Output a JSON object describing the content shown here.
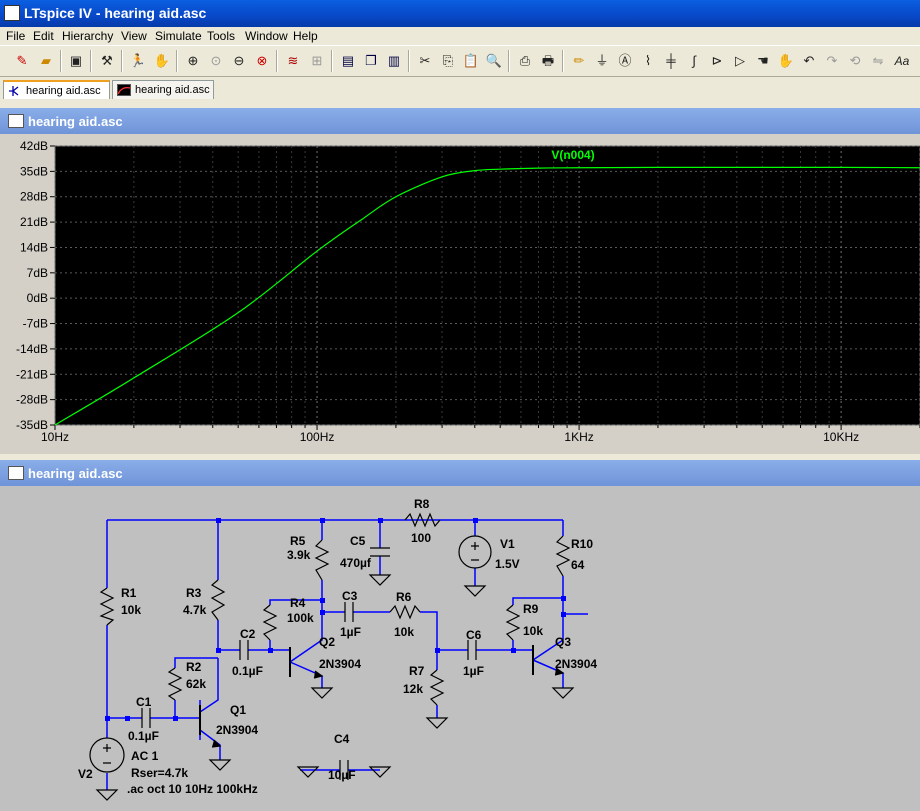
{
  "window": {
    "title": "LTspice IV - hearing aid.asc"
  },
  "menu": [
    "File",
    "Edit",
    "Hierarchy",
    "View",
    "Simulate",
    "Tools",
    "Window",
    "Help"
  ],
  "toolbar_icons": [
    "new-schematic-icon",
    "open-icon",
    "save-icon",
    "control-panel-icon",
    "run-icon",
    "pause-icon",
    "zoom-in-icon",
    "pan-icon",
    "zoom-out-icon",
    "zoom-cancel-icon",
    "autorange-icon",
    "fit-icon",
    "tile-horizontal-icon",
    "cascade-icon",
    "tile-vertical-icon",
    "cut-icon",
    "copy-icon",
    "paste-icon",
    "find-icon",
    "print-setup-icon",
    "print-icon",
    "draw-wire-icon",
    "ground-icon",
    "label-net-icon",
    "resistor-icon",
    "capacitor-icon",
    "inductor-icon",
    "diode-icon",
    "component-icon",
    "move-icon",
    "drag-icon",
    "undo-icon",
    "redo-icon",
    "rotate-icon",
    "mirror-icon",
    "text-icon"
  ],
  "tabs": [
    {
      "label": "hearing aid.asc",
      "icon": "schematic-icon"
    },
    {
      "label": "hearing aid.asc",
      "icon": "waveform-icon"
    }
  ],
  "plot_pane": {
    "title": "hearing aid.asc"
  },
  "schematic_pane": {
    "title": "hearing aid.asc"
  },
  "chart_data": {
    "type": "line",
    "series": [
      {
        "name": "V(n004)",
        "color": "#00ff00",
        "x": [
          10,
          20,
          50,
          100,
          150,
          200,
          300,
          400,
          500,
          700,
          1000,
          2000,
          5000,
          10000,
          20000
        ],
        "y": [
          -35,
          -22,
          -4,
          13,
          22,
          28,
          33.5,
          35.2,
          35.6,
          35.9,
          36,
          36.1,
          36.1,
          36.1,
          36
        ]
      }
    ],
    "x_scale": "log",
    "xlim": [
      10,
      20000
    ],
    "ylim": [
      -35,
      42
    ],
    "y_ticks": [
      "42dB",
      "35dB",
      "28dB",
      "21dB",
      "14dB",
      "7dB",
      "0dB",
      "-7dB",
      "-14dB",
      "-21dB",
      "-28dB",
      "-35dB"
    ],
    "x_ticks": [
      "10Hz",
      "100Hz",
      "1KHz",
      "10KHz"
    ],
    "grid": true,
    "background": "#000000"
  },
  "schematic": {
    "labels": {
      "R1": "R1",
      "R1v": "10k",
      "R2": "R2",
      "R2v": "62k",
      "R3": "R3",
      "R3v": "4.7k",
      "R4": "R4",
      "R4v": "100k",
      "R5": "R5",
      "R5v": "3.9k",
      "R6": "R6",
      "R6v": "10k",
      "R7": "R7",
      "R7v": "12k",
      "R8": "R8",
      "R8v": "100",
      "R9": "R9",
      "R9v": "10k",
      "R10": "R10",
      "R10v": "64",
      "C1": "C1",
      "C1v": "0.1µF",
      "C2": "C2",
      "C2v": "0.1µF",
      "C3": "C3",
      "C3v": "1µF",
      "C4": "C4",
      "C4v": "10µF",
      "C5": "C5",
      "C5v": "470µf",
      "C6": "C6",
      "C6v": "1µF",
      "Q1": "Q1",
      "Q1v": "2N3904",
      "Q2": "Q2",
      "Q2v": "2N3904",
      "Q3": "Q3",
      "Q3v": "2N3904",
      "V1": "V1",
      "V1v": "1.5V",
      "V2": "V2",
      "V2v1": "AC 1",
      "V2v2": "Rser=4.7k",
      "directive": ".ac oct 10 10Hz 100kHz"
    }
  }
}
